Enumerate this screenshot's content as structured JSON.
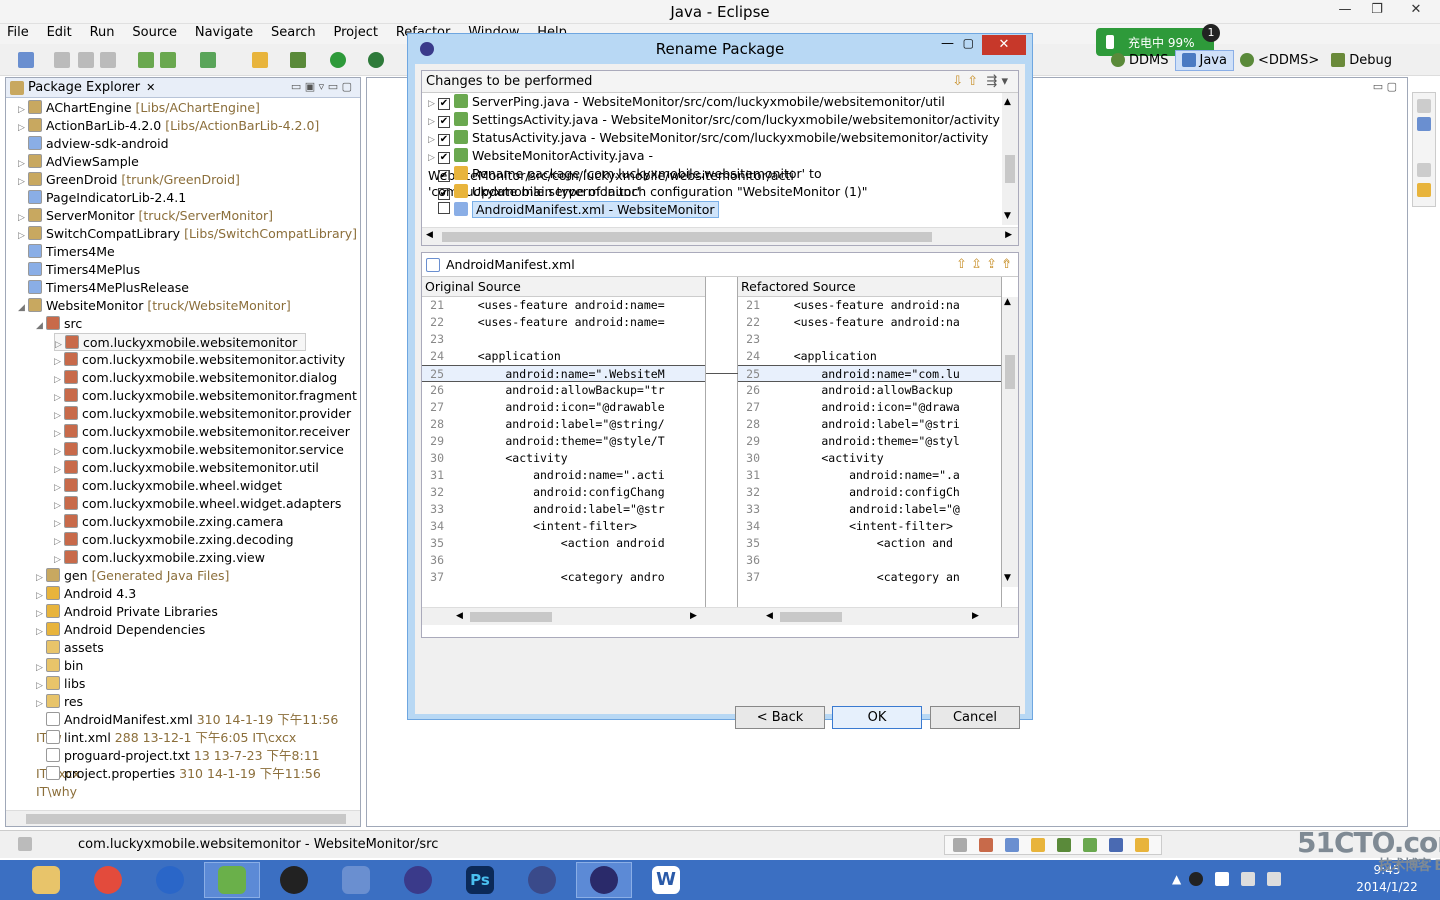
{
  "window": {
    "title": "Java - Eclipse"
  },
  "menu": [
    "File",
    "Edit",
    "Run",
    "Source",
    "Navigate",
    "Search",
    "Project",
    "Refactor",
    "Window",
    "Help"
  ],
  "battery": {
    "label": "充电中 99%",
    "badge": "1"
  },
  "perspectives": [
    "DDMS",
    "Java",
    "<DDMS>",
    "Debug"
  ],
  "package_explorer": {
    "title": "Package Explorer",
    "items": [
      {
        "name": "AChartEngine",
        "detail": "[Libs/AChartEngine]"
      },
      {
        "name": "ActionBarLib-4.2.0",
        "detail": "[Libs/ActionBarLib-4.2.0]"
      },
      {
        "name": "adview-sdk-android",
        "detail": ""
      },
      {
        "name": "AdViewSample",
        "detail": ""
      },
      {
        "name": "GreenDroid",
        "detail": "[trunk/GreenDroid]"
      },
      {
        "name": "PageIndicatorLib-2.4.1",
        "detail": ""
      },
      {
        "name": "ServerMonitor",
        "detail": "[truck/ServerMonitor]"
      },
      {
        "name": "SwitchCompatLibrary",
        "detail": "[Libs/SwitchCompatLibrary]"
      },
      {
        "name": "Timers4Me",
        "detail": ""
      },
      {
        "name": "Timers4MePlus",
        "detail": ""
      },
      {
        "name": "Timers4MePlusRelease",
        "detail": ""
      },
      {
        "name": "WebsiteMonitor",
        "detail": "[truck/WebsiteMonitor]"
      },
      {
        "name": "src",
        "detail": ""
      },
      {
        "name": "com.luckyxmobile.websitemonitor",
        "detail": ""
      },
      {
        "name": "com.luckyxmobile.websitemonitor.activity",
        "detail": ""
      },
      {
        "name": "com.luckyxmobile.websitemonitor.dialog",
        "detail": ""
      },
      {
        "name": "com.luckyxmobile.websitemonitor.fragment",
        "detail": ""
      },
      {
        "name": "com.luckyxmobile.websitemonitor.provider",
        "detail": ""
      },
      {
        "name": "com.luckyxmobile.websitemonitor.receiver",
        "detail": ""
      },
      {
        "name": "com.luckyxmobile.websitemonitor.service",
        "detail": ""
      },
      {
        "name": "com.luckyxmobile.websitemonitor.util",
        "detail": ""
      },
      {
        "name": "com.luckyxmobile.wheel.widget",
        "detail": ""
      },
      {
        "name": "com.luckyxmobile.wheel.widget.adapters",
        "detail": ""
      },
      {
        "name": "com.luckyxmobile.zxing.camera",
        "detail": ""
      },
      {
        "name": "com.luckyxmobile.zxing.decoding",
        "detail": ""
      },
      {
        "name": "com.luckyxmobile.zxing.view",
        "detail": ""
      },
      {
        "name": "gen",
        "detail": "[Generated Java Files]"
      },
      {
        "name": "Android 4.3",
        "detail": ""
      },
      {
        "name": "Android Private Libraries",
        "detail": ""
      },
      {
        "name": "Android Dependencies",
        "detail": ""
      },
      {
        "name": "assets",
        "detail": ""
      },
      {
        "name": "bin",
        "detail": ""
      },
      {
        "name": "libs",
        "detail": ""
      },
      {
        "name": "res",
        "detail": ""
      },
      {
        "name": "AndroidManifest.xml",
        "detail": "310  14-1-19 下午11:56  IT\\w"
      },
      {
        "name": "lint.xml",
        "detail": "288  13-12-1 下午6:05  IT\\cxcx"
      },
      {
        "name": "proguard-project.txt",
        "detail": "13  13-7-23 下午8:11  IT\\cxcx"
      },
      {
        "name": "project.properties",
        "detail": "310  14-1-19 下午11:56  IT\\why"
      }
    ]
  },
  "dialog": {
    "title": "Rename Package",
    "changes_label": "Changes to be performed",
    "changes": [
      {
        "text": "ServerPing.java - WebsiteMonitor/src/com/luckyxmobile/websitemonitor/util",
        "checked": "✔"
      },
      {
        "text": "SettingsActivity.java - WebsiteMonitor/src/com/luckyxmobile/websitemonitor/activity",
        "checked": "✔"
      },
      {
        "text": "StatusActivity.java - WebsiteMonitor/src/com/luckyxmobile/websitemonitor/activity",
        "checked": "✔"
      },
      {
        "text": "WebsiteMonitorActivity.java - WebsiteMonitor/src/com/luckyxmobile/websitemonitor/acti",
        "checked": "✔"
      },
      {
        "text": "Rename package 'com.luckyxmobile.websitemonitor' to 'com.luckyxmobile.servermonitor'",
        "checked": "✔"
      },
      {
        "text": "Update main type of launch configuration \"WebsiteMonitor (1)\"",
        "checked": "✔"
      },
      {
        "text": "AndroidManifest.xml - WebsiteMonitor",
        "checked": ""
      }
    ],
    "file_label": "AndroidManifest.xml",
    "original_label": "Original Source",
    "refactored_label": "Refactored Source",
    "original_lines": [
      {
        "n": "21",
        "code": "    <uses-feature android:name="
      },
      {
        "n": "22",
        "code": "    <uses-feature android:name="
      },
      {
        "n": "23",
        "code": ""
      },
      {
        "n": "24",
        "code": "    <application"
      },
      {
        "n": "25",
        "code": "        android:name=\".WebsiteM"
      },
      {
        "n": "26",
        "code": "        android:allowBackup=\"tr"
      },
      {
        "n": "27",
        "code": "        android:icon=\"@drawable"
      },
      {
        "n": "28",
        "code": "        android:label=\"@string/"
      },
      {
        "n": "29",
        "code": "        android:theme=\"@style/T"
      },
      {
        "n": "30",
        "code": "        <activity"
      },
      {
        "n": "31",
        "code": "            android:name=\".acti"
      },
      {
        "n": "32",
        "code": "            android:configChang"
      },
      {
        "n": "33",
        "code": "            android:label=\"@str"
      },
      {
        "n": "34",
        "code": "            <intent-filter>"
      },
      {
        "n": "35",
        "code": "                <action android"
      },
      {
        "n": "36",
        "code": ""
      },
      {
        "n": "37",
        "code": "                <category andro"
      }
    ],
    "refactored_lines": [
      {
        "n": "21",
        "code": "    <uses-feature android:na"
      },
      {
        "n": "22",
        "code": "    <uses-feature android:na"
      },
      {
        "n": "23",
        "code": ""
      },
      {
        "n": "24",
        "code": "    <application"
      },
      {
        "n": "25",
        "code": "        android:name=\"com.lu"
      },
      {
        "n": "26",
        "code": "        android:allowBackup"
      },
      {
        "n": "27",
        "code": "        android:icon=\"@drawa"
      },
      {
        "n": "28",
        "code": "        android:label=\"@stri"
      },
      {
        "n": "29",
        "code": "        android:theme=\"@styl"
      },
      {
        "n": "30",
        "code": "        <activity"
      },
      {
        "n": "31",
        "code": "            android:name=\".a"
      },
      {
        "n": "32",
        "code": "            android:configCh"
      },
      {
        "n": "33",
        "code": "            android:label=\"@"
      },
      {
        "n": "34",
        "code": "            <intent-filter>"
      },
      {
        "n": "35",
        "code": "                <action and"
      },
      {
        "n": "36",
        "code": ""
      },
      {
        "n": "37",
        "code": "                <category an"
      }
    ],
    "buttons": {
      "back": "< Back",
      "ok": "OK",
      "cancel": "Cancel"
    }
  },
  "status": {
    "text": "com.luckyxmobile.websitemonitor - WebsiteMonitor/src"
  },
  "clock": {
    "time": "9:45",
    "date": "2014/1/22"
  },
  "watermark": {
    "text": "51CTO.com",
    "sub": "技术博客 Blog"
  },
  "colors": {
    "accent": "#3b6fc2",
    "dialog_frame": "#b8d8f4",
    "close": "#c7382a"
  }
}
